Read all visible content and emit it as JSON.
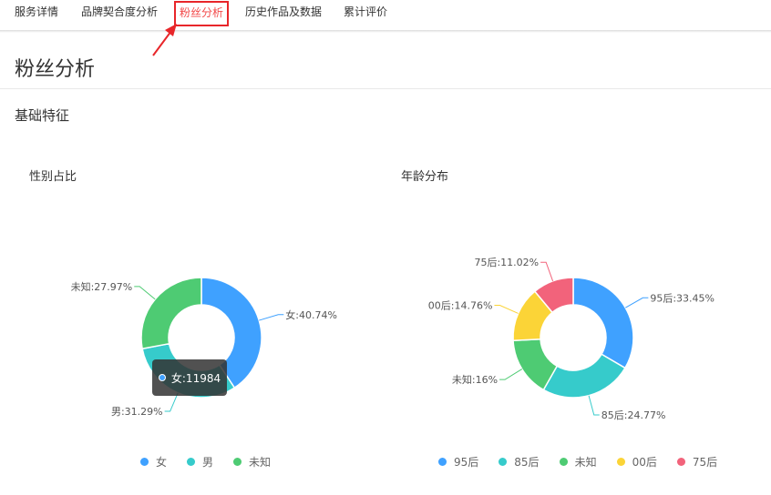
{
  "tabs": [
    {
      "label": "服务详情",
      "active": false
    },
    {
      "label": "品牌契合度分析",
      "active": false
    },
    {
      "label": "粉丝分析",
      "active": true
    },
    {
      "label": "历史作品及数据",
      "active": false
    },
    {
      "label": "累计评价",
      "active": false
    }
  ],
  "page_title": "粉丝分析",
  "section_title": "基础特征",
  "gender_chart": {
    "title": "性别占比"
  },
  "age_chart": {
    "title": "年龄分布"
  },
  "tooltip": {
    "text": "女:11984"
  },
  "colors": {
    "accent_red": "#e8262a",
    "blue": "#3fa1ff",
    "teal": "#36cbcb",
    "green": "#4ecb73",
    "yellow": "#fbd437",
    "pink": "#f2637b"
  },
  "chart_data": [
    {
      "type": "pie",
      "title": "性别占比",
      "categories": [
        "女",
        "男",
        "未知"
      ],
      "values": [
        40.74,
        31.29,
        27.97
      ],
      "slice_labels": [
        "女:40.74%",
        "男:31.29%",
        "未知:27.97%"
      ],
      "colors": [
        "#3fa1ff",
        "#36cbcb",
        "#4ecb73"
      ],
      "legend": "bottom",
      "donut": true
    },
    {
      "type": "pie",
      "title": "年龄分布",
      "categories": [
        "95后",
        "85后",
        "未知",
        "00后",
        "75后"
      ],
      "values": [
        33.45,
        24.77,
        16,
        14.76,
        11.02
      ],
      "slice_labels": [
        "95后:33.45%",
        "85后:24.77%",
        "未知:16%",
        "00后:14.76%",
        "75后:11.02%"
      ],
      "colors": [
        "#3fa1ff",
        "#36cbcb",
        "#4ecb73",
        "#fbd437",
        "#f2637b"
      ],
      "legend": "bottom",
      "donut": true
    }
  ]
}
